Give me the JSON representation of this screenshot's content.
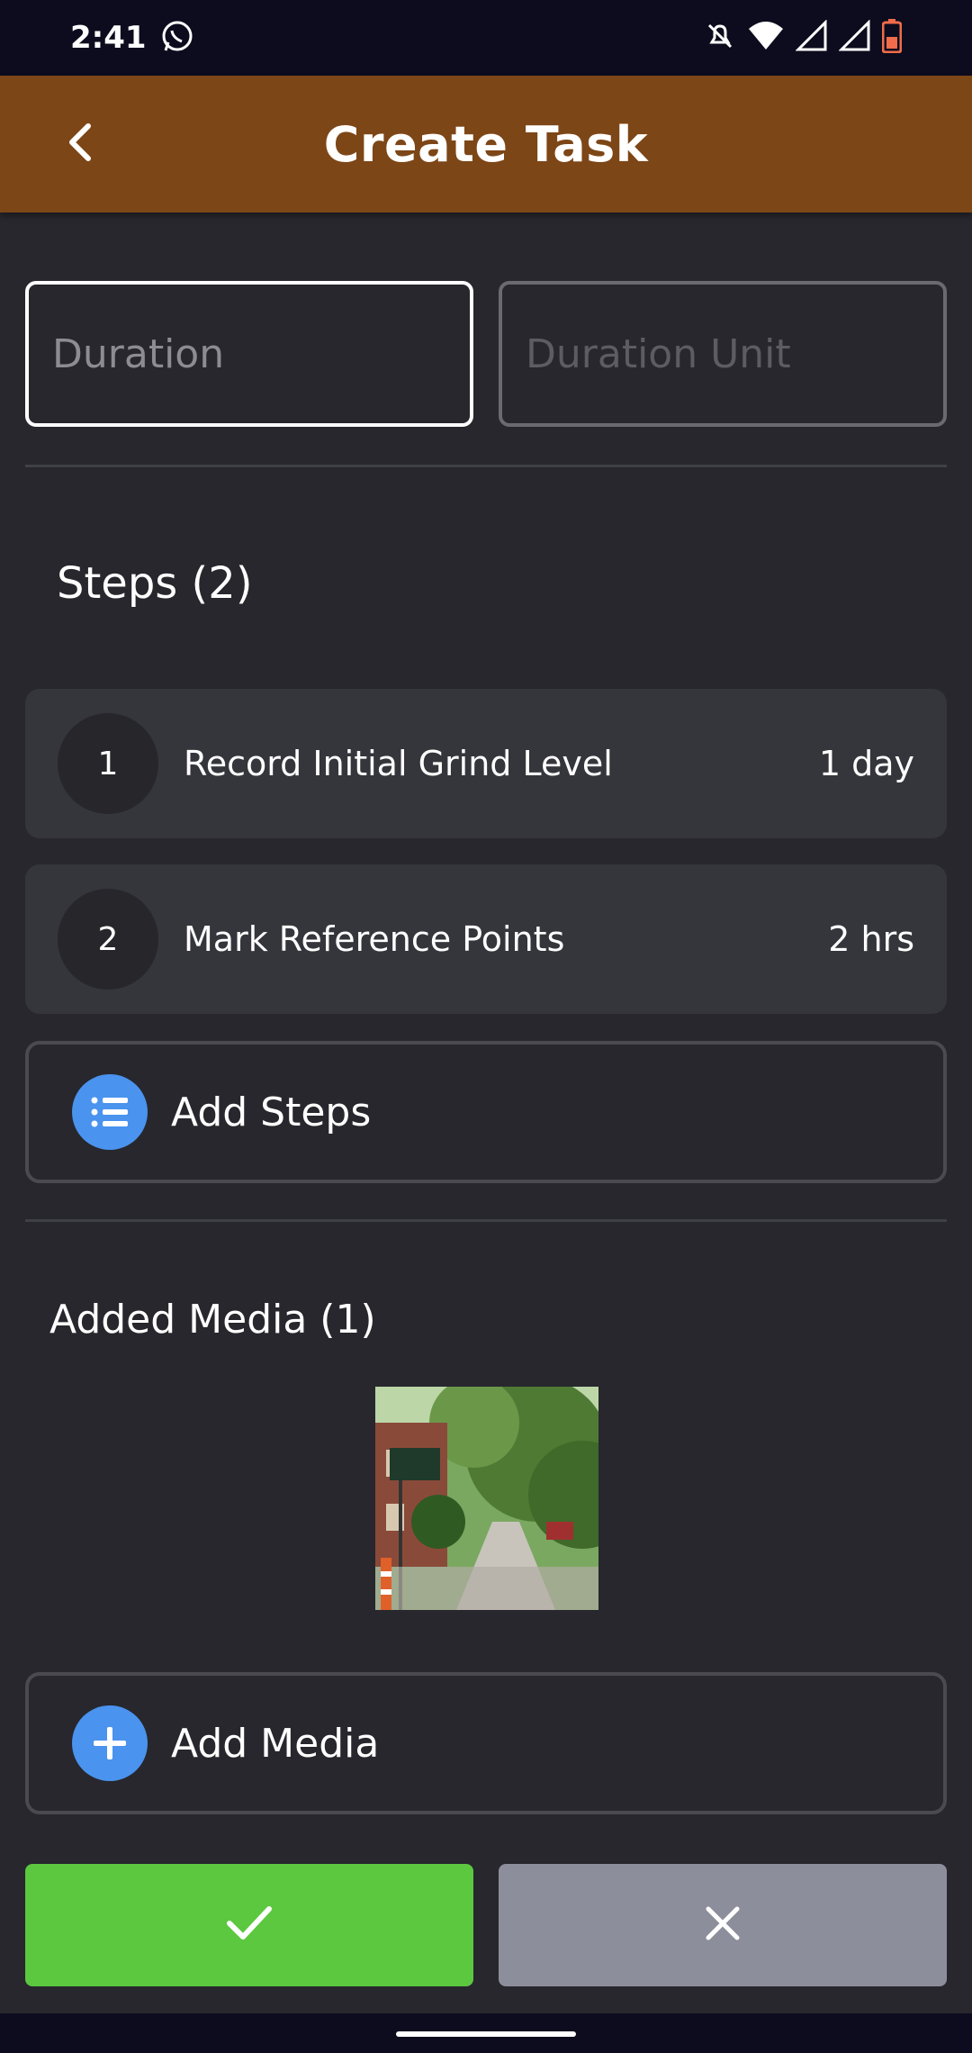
{
  "status_bar": {
    "time": "2:41",
    "icons": [
      "whatsapp-icon",
      "mute-icon",
      "wifi-icon",
      "signal-icon",
      "signal-icon",
      "battery-icon"
    ]
  },
  "header": {
    "title": "Create Task",
    "back_icon": "chevron-left-icon"
  },
  "form": {
    "duration_placeholder": "Duration",
    "duration_unit_placeholder": "Duration Unit"
  },
  "steps": {
    "title": "Steps (2)",
    "items": [
      {
        "number": "1",
        "title": "Record Initial Grind Level",
        "duration": "1 day"
      },
      {
        "number": "2",
        "title": "Mark Reference Points",
        "duration": "2 hrs"
      }
    ],
    "add_label": "Add Steps",
    "add_icon": "list-icon"
  },
  "media": {
    "title": "Added Media (1)",
    "thumbnail": "street-photo",
    "add_label": "Add Media",
    "add_icon": "plus-icon"
  },
  "buttons": {
    "confirm_icon": "check-icon",
    "cancel_icon": "close-icon"
  },
  "colors": {
    "header": "#7d4617",
    "background": "#27272d",
    "confirm": "#5bc83f",
    "cancel": "#8d8e9b",
    "accent": "#4a93ee"
  }
}
